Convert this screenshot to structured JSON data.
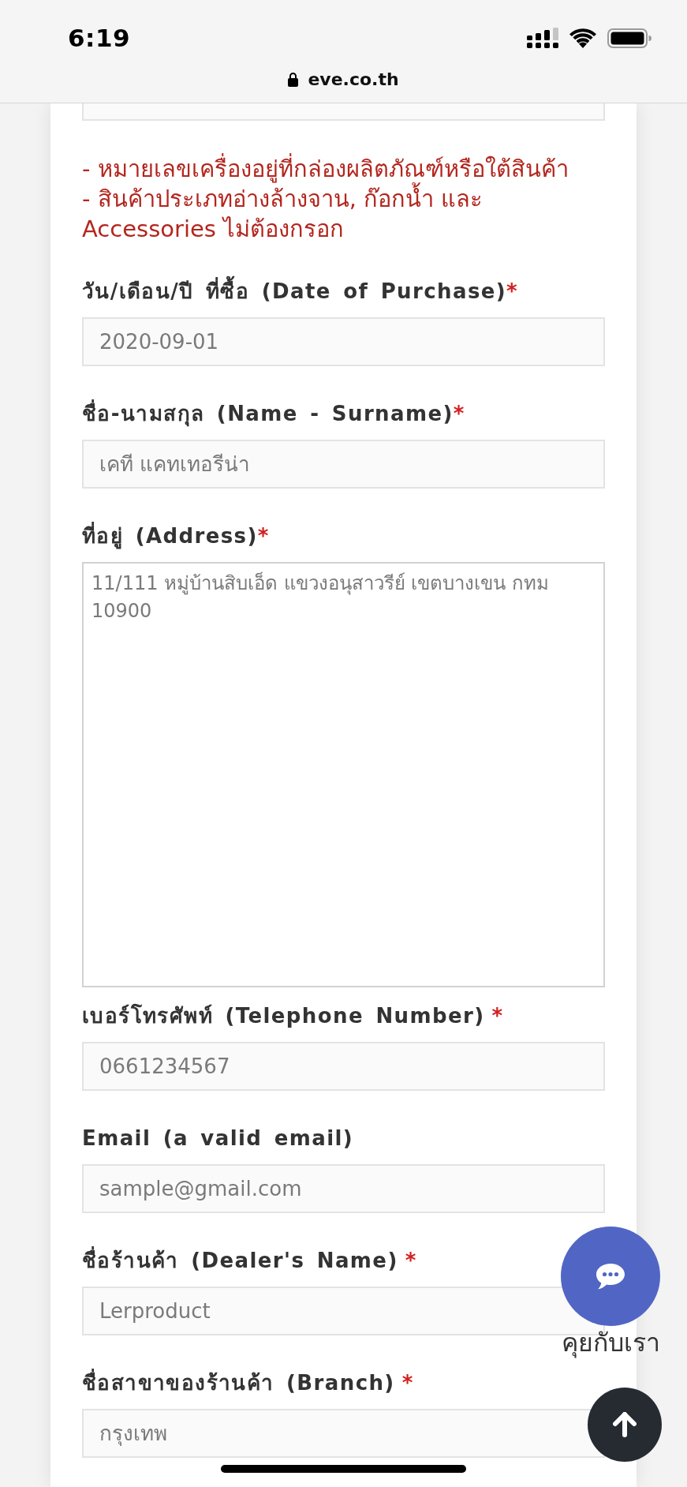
{
  "status_bar": {
    "time": "6:19"
  },
  "address_bar": {
    "url": "eve.co.th"
  },
  "form": {
    "items": [
      {
        "kind": "input"
      },
      {
        "kind": "note",
        "text": "- หมายเลขเครื่องอยู่ที่กล่องผลิตภัณฑ์หรือใต้สินค้า"
      },
      {
        "kind": "note",
        "text": "- สินค้าประเภทอ่างล้างจาน, ก๊อกน้ำ และ\nAccessories ไม่ต้องกรอก"
      },
      {
        "kind": "input",
        "label": "วัน/เดือน/ปี ที่ซื้อ (Date of Purchase)",
        "mark": "*",
        "placeholder": "2020-09-01"
      },
      {
        "kind": "input",
        "label": "ชื่อ-นามสกุล (Name - Surname)",
        "mark": "*",
        "placeholder": "เคที แคทเทอรีน่า"
      },
      {
        "kind": "textarea",
        "label": "ที่อยู่ (Address)",
        "mark": "*",
        "placeholder": "11/111 หมู่บ้านสิบเอ็ด แขวงอนุสาวรีย์ เขตบางเขน กทม 10900"
      },
      {
        "kind": "input",
        "label": "เบอร์โทรศัพท์ (Telephone Number)",
        "mark": " *",
        "placeholder": "0661234567"
      },
      {
        "kind": "input",
        "label": "Email (a valid email)",
        "placeholder": "sample@gmail.com"
      },
      {
        "kind": "input",
        "label": "ชื่อร้านค้า (Dealer's Name)",
        "mark": " *",
        "placeholder": "Lerproduct"
      },
      {
        "kind": "input",
        "label": "ชื่อสาขาของร้านค้า (Branch)",
        "mark": " *",
        "placeholder": "กรุงเทพ"
      }
    ]
  },
  "chat_button": {
    "label": "คุยกับเรา"
  }
}
